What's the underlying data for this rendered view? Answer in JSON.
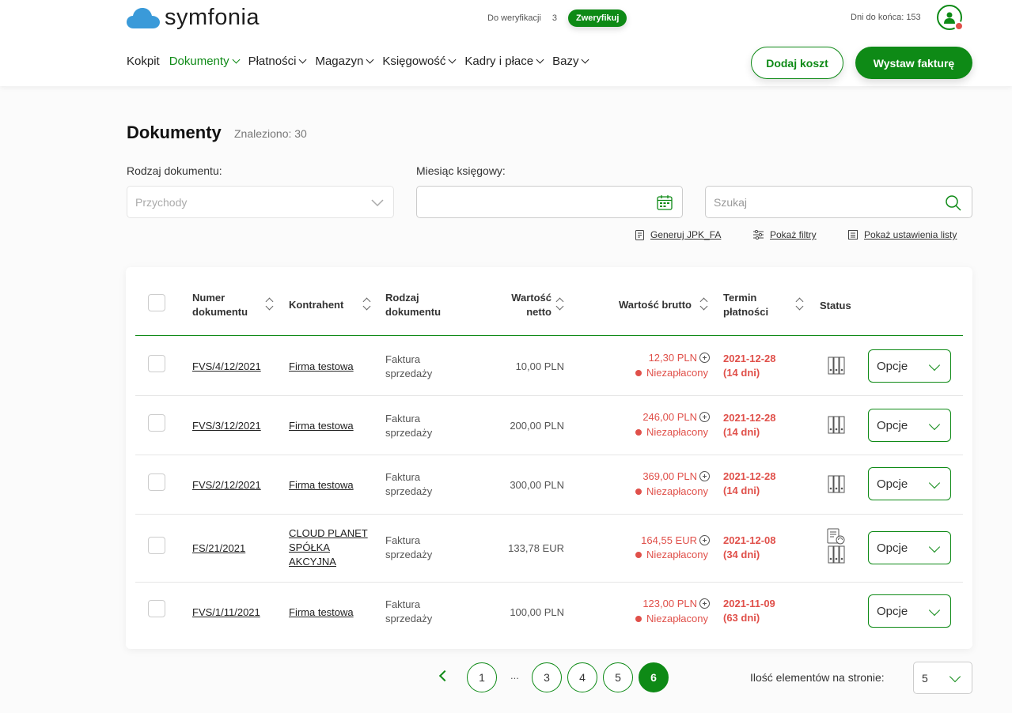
{
  "brand": {
    "name": "symfonia",
    "accent": "#0e8a16",
    "danger": "#e0504a"
  },
  "topbar": {
    "verify_label": "Do weryfikacji",
    "verify_count": "3",
    "verify_button": "Zweryfikuj",
    "days_left": "Dni do końca: 153"
  },
  "nav": {
    "items": [
      {
        "label": "Kokpit",
        "dropdown": false
      },
      {
        "label": "Dokumenty",
        "dropdown": true,
        "active": true
      },
      {
        "label": "Płatności",
        "dropdown": true
      },
      {
        "label": "Magazyn",
        "dropdown": true
      },
      {
        "label": "Księgowość",
        "dropdown": true
      },
      {
        "label": "Kadry i płace",
        "dropdown": true
      },
      {
        "label": "Bazy",
        "dropdown": true
      }
    ],
    "add_cost": "Dodaj koszt",
    "issue_invoice": "Wystaw fakturę"
  },
  "page": {
    "title": "Dokumenty",
    "found": "Znaleziono: 30"
  },
  "filters": {
    "doc_type_label": "Rodzaj dokumentu:",
    "doc_type_value": "Przychody",
    "month_label": "Miesiąc księgowy:",
    "month_value": "",
    "search_placeholder": "Szukaj"
  },
  "actions": {
    "jpk": "Generuj JPK_FA",
    "filters": "Pokaż filtry",
    "list_settings": "Pokaż ustawienia listy"
  },
  "table": {
    "headers": {
      "number": [
        "Numer",
        "dokumentu"
      ],
      "contractor": "Kontrahent",
      "doc_type": [
        "Rodzaj",
        "dokumentu"
      ],
      "net": [
        "Wartość",
        "netto"
      ],
      "gross": "Wartość brutto",
      "due": [
        "Termin",
        "płatności"
      ],
      "status": "Status"
    },
    "options_label": "Opcje",
    "rows": [
      {
        "number": "FVS/4/12/2021",
        "contractor": [
          "Firma testowa"
        ],
        "type": [
          "Faktura",
          "sprzedaży"
        ],
        "net": "10,00 PLN",
        "gross": "12,30 PLN",
        "payment": "Niezapłacony",
        "due_date": "2021-12-28",
        "due_days": "(14 dni)",
        "status_icons": [
          "binders-icon"
        ]
      },
      {
        "number": "FVS/3/12/2021",
        "contractor": [
          "Firma testowa"
        ],
        "type": [
          "Faktura",
          "sprzedaży"
        ],
        "net": "200,00 PLN",
        "gross": "246,00 PLN",
        "payment": "Niezapłacony",
        "due_date": "2021-12-28",
        "due_days": "(14 dni)",
        "status_icons": [
          "binders-icon"
        ]
      },
      {
        "number": "FVS/2/12/2021",
        "contractor": [
          "Firma testowa"
        ],
        "type": [
          "Faktura",
          "sprzedaży"
        ],
        "net": "300,00 PLN",
        "gross": "369,00 PLN",
        "payment": "Niezapłacony",
        "due_date": "2021-12-28",
        "due_days": "(14 dni)",
        "status_icons": [
          "binders-icon"
        ]
      },
      {
        "number": "FS/21/2021",
        "contractor": [
          "CLOUD PLANET",
          "SPÓŁKA",
          "AKCYJNA"
        ],
        "type": [
          "Faktura",
          "sprzedaży"
        ],
        "net": "133,78 EUR",
        "gross": "164,55 EUR",
        "payment": "Niezapłacony",
        "due_date": "2021-12-08",
        "due_days": "(34 dni)",
        "status_icons": [
          "document-sync-icon",
          "binders-icon"
        ]
      },
      {
        "number": "FVS/1/11/2021",
        "contractor": [
          "Firma testowa"
        ],
        "type": [
          "Faktura",
          "sprzedaży"
        ],
        "net": "100,00 PLN",
        "gross": "123,00 PLN",
        "payment": "Niezapłacony",
        "due_date": "2021-11-09",
        "due_days": "(63 dni)",
        "status_icons": []
      }
    ]
  },
  "pagination": {
    "pages": [
      "1",
      "...",
      "3",
      "4",
      "5",
      "6"
    ],
    "current": "6",
    "per_page_label": "Ilość elementów na stronie:",
    "per_page_value": "5"
  }
}
